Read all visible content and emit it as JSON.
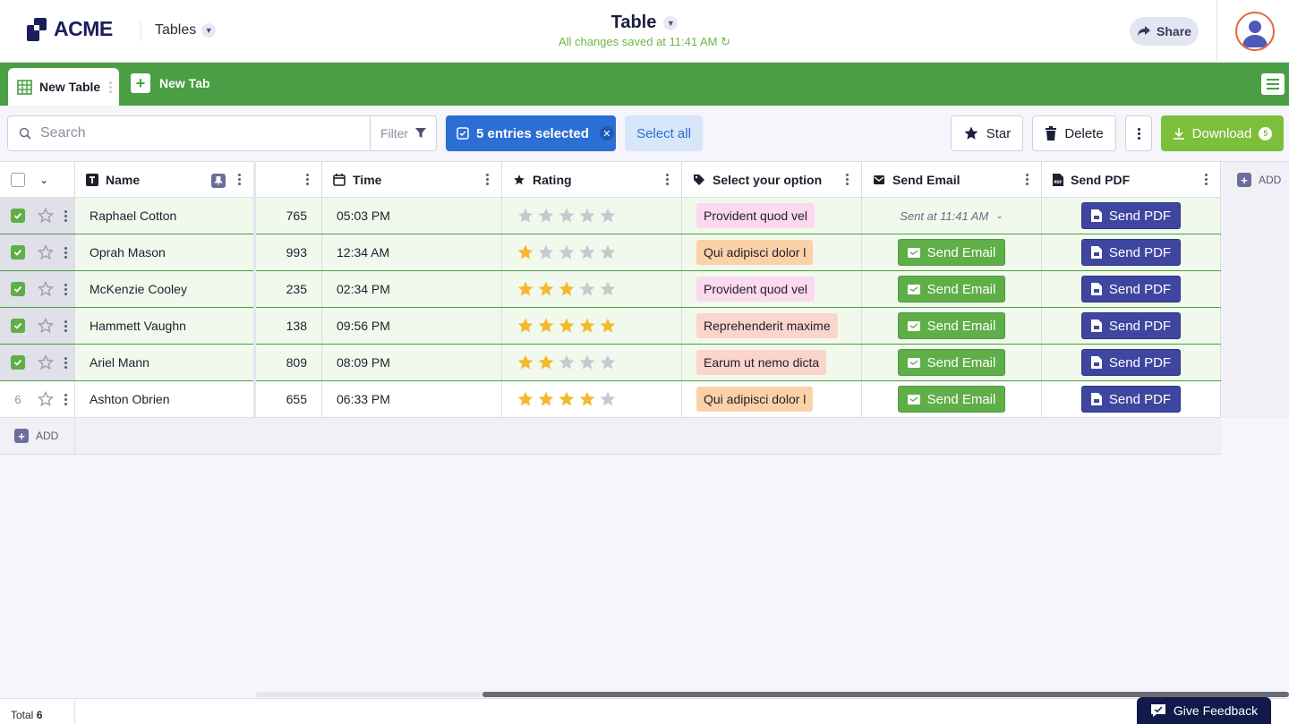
{
  "header": {
    "logo_text": "ACME",
    "tables_menu": "Tables",
    "title": "Table",
    "saved_status": "All changes saved at 11:41 AM",
    "share_label": "Share"
  },
  "tabs": {
    "active": "New Table",
    "new_tab": "New Tab"
  },
  "toolbar": {
    "search_placeholder": "Search",
    "filter_label": "Filter",
    "selected_label": "5 entries selected",
    "select_all": "Select all",
    "star_label": "Star",
    "delete_label": "Delete",
    "download_label": "Download",
    "download_count": "5"
  },
  "columns": {
    "name": "Name",
    "time": "Time",
    "rating": "Rating",
    "option": "Select your option",
    "email": "Send Email",
    "pdf": "Send PDF",
    "add": "ADD"
  },
  "rows": [
    {
      "name": "Raphael Cotton",
      "number": "765",
      "time": "05:03 PM",
      "rating": 0,
      "option": "Provident quod vel",
      "option_color": "#fbd9ee",
      "email_status": "Sent at 11:41 AM",
      "email_sent": true,
      "selected": true,
      "row_number": ""
    },
    {
      "name": "Oprah Mason",
      "number": "993",
      "time": "12:34 AM",
      "rating": 1,
      "option": "Qui adipisci dolor l",
      "option_color": "#fbd2a8",
      "email_status": "Send Email",
      "email_sent": false,
      "selected": true,
      "row_number": ""
    },
    {
      "name": "McKenzie Cooley",
      "number": "235",
      "time": "02:34 PM",
      "rating": 3,
      "option": "Provident quod vel",
      "option_color": "#fbd9ee",
      "email_status": "Send Email",
      "email_sent": false,
      "selected": true,
      "row_number": ""
    },
    {
      "name": "Hammett Vaughn",
      "number": "138",
      "time": "09:56 PM",
      "rating": 5,
      "option": "Reprehenderit maxime",
      "option_color": "#fbd4cc",
      "email_status": "Send Email",
      "email_sent": false,
      "selected": true,
      "row_number": ""
    },
    {
      "name": "Ariel Mann",
      "number": "809",
      "time": "08:09 PM",
      "rating": 2,
      "option": "Earum ut nemo dicta",
      "option_color": "#fbd4cc",
      "email_status": "Send Email",
      "email_sent": false,
      "selected": true,
      "row_number": ""
    },
    {
      "name": "Ashton Obrien",
      "number": "655",
      "time": "06:33 PM",
      "rating": 4,
      "option": "Qui adipisci dolor l",
      "option_color": "#fbd2a8",
      "email_status": "Send Email",
      "email_sent": false,
      "selected": false,
      "row_number": "6"
    }
  ],
  "pdf_button": "Send PDF",
  "add_row": "ADD",
  "footer": {
    "total_label": "Total",
    "total_value": "6",
    "feedback": "Give Feedback"
  },
  "colors": {
    "brand_green": "#4a9e44",
    "accent_blue": "#2c6fd4",
    "pdf_blue": "#3f46a0",
    "star_gold": "#f5b82e"
  }
}
